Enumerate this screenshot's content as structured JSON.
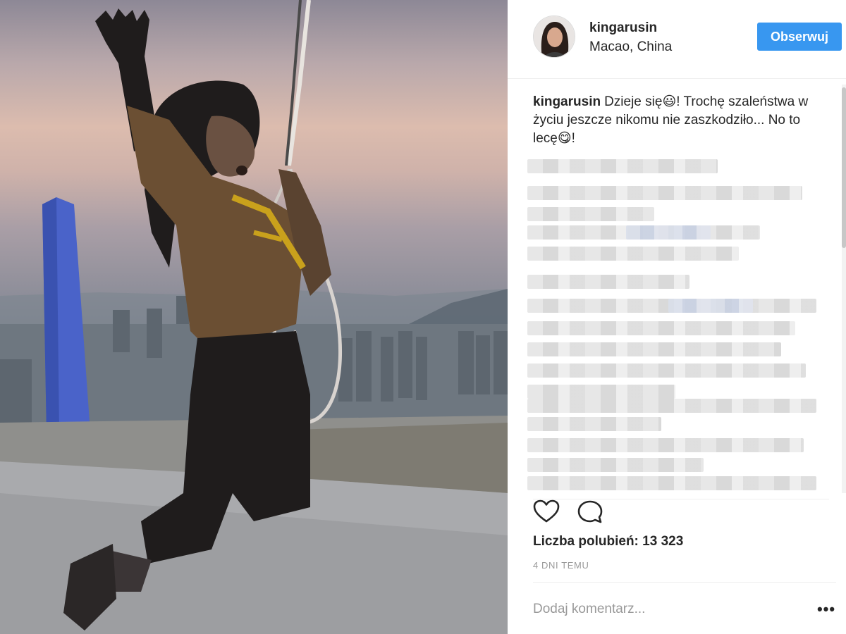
{
  "post": {
    "username": "kingarusin",
    "location": "Macao, China",
    "follow_label": "Obserwuj",
    "caption_user": "kingarusin",
    "caption_text": "Dzieje się😃! Trochę szaleństwa w życiu jeszcze nikomu nie zaszkodziło... No to lecę😋!",
    "likes_text": "Liczba polubień: 13 323",
    "timestamp": "4 DNI TEMU",
    "comment_placeholder": "Dodaj komentarz...",
    "more_label": "•••"
  },
  "icons": {
    "like": "heart-icon",
    "comment": "comment-icon",
    "more": "more-options-icon"
  },
  "colors": {
    "follow_button": "#3897f0",
    "text": "#262626",
    "muted": "#999999"
  }
}
